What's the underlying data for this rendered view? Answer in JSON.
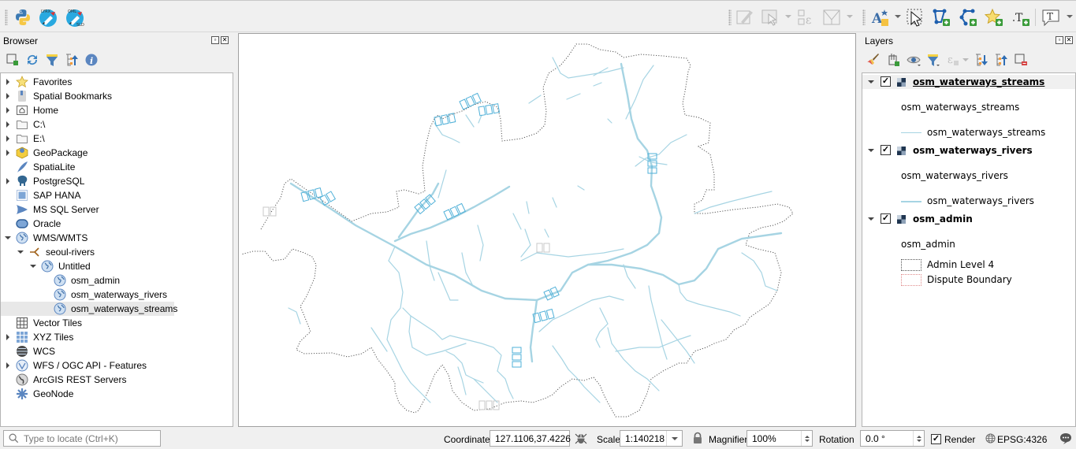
{
  "toolbar": {
    "left_icons": [
      "python-console-icon",
      "lyrx-plugin-icon",
      "qml-sld-plugin-icon"
    ],
    "lyrx_label": "LYRX",
    "qml_label": "QML",
    "sld_label": "SLD",
    "right_icons": [
      "digitize-icon",
      "select-features-icon",
      "vertex-tool-icon",
      "mesh-editing-icon",
      "label-tool-icon",
      "select-by-area-icon",
      "add-polygon-icon",
      "add-line-icon",
      "add-point-icon",
      "add-text-icon",
      "annotation-icon"
    ]
  },
  "browser": {
    "title": "Browser",
    "tools": [
      "add-layer-icon",
      "refresh-icon",
      "filter-icon",
      "collapse-all-icon",
      "info-icon"
    ],
    "items": [
      {
        "label": "Favorites",
        "icon": "star-icon",
        "expand": "collapsed",
        "level": 0
      },
      {
        "label": "Spatial Bookmarks",
        "icon": "bookmark-icon",
        "expand": "collapsed",
        "level": 0
      },
      {
        "label": "Home",
        "icon": "home-folder-icon",
        "expand": "collapsed",
        "level": 0
      },
      {
        "label": "C:\\",
        "icon": "folder-icon",
        "expand": "collapsed",
        "level": 0
      },
      {
        "label": "E:\\",
        "icon": "folder-icon",
        "expand": "collapsed",
        "level": 0
      },
      {
        "label": "GeoPackage",
        "icon": "geopackage-icon",
        "expand": "collapsed",
        "level": 0
      },
      {
        "label": "SpatiaLite",
        "icon": "spatialite-feather-icon",
        "expand": "none",
        "level": 0
      },
      {
        "label": "PostgreSQL",
        "icon": "postgresql-elephant-icon",
        "expand": "collapsed",
        "level": 0
      },
      {
        "label": "SAP HANA",
        "icon": "sap-hana-icon",
        "expand": "none",
        "level": 0
      },
      {
        "label": "MS SQL Server",
        "icon": "mssql-icon",
        "expand": "none",
        "level": 0
      },
      {
        "label": "Oracle",
        "icon": "oracle-icon",
        "expand": "none",
        "level": 0
      },
      {
        "label": "WMS/WMTS",
        "icon": "globe-icon",
        "expand": "expanded",
        "level": 0
      },
      {
        "label": "seoul-rivers",
        "icon": "connection-icon",
        "expand": "expanded",
        "level": 1
      },
      {
        "label": "Untitled",
        "icon": "globe-icon",
        "expand": "expanded",
        "level": 2
      },
      {
        "label": "osm_admin",
        "icon": "globe-icon",
        "expand": "none",
        "level": 3
      },
      {
        "label": "osm_waterways_rivers",
        "icon": "globe-icon",
        "expand": "none",
        "level": 3
      },
      {
        "label": "osm_waterways_streams",
        "icon": "globe-icon",
        "expand": "none",
        "level": 3,
        "selected": true
      },
      {
        "label": "Vector Tiles",
        "icon": "vector-tiles-icon",
        "expand": "none",
        "level": 0
      },
      {
        "label": "XYZ Tiles",
        "icon": "xyz-tiles-icon",
        "expand": "collapsed",
        "level": 0
      },
      {
        "label": "WCS",
        "icon": "wcs-icon",
        "expand": "none",
        "level": 0
      },
      {
        "label": "WFS / OGC API - Features",
        "icon": "wfs-icon",
        "expand": "collapsed",
        "level": 0
      },
      {
        "label": "ArcGIS REST Servers",
        "icon": "arcgis-icon",
        "expand": "none",
        "level": 0
      },
      {
        "label": "GeoNode",
        "icon": "geonode-icon",
        "expand": "none",
        "level": 0
      }
    ]
  },
  "layers": {
    "title": "Layers",
    "tools": [
      "style-manager-icon",
      "add-group-icon",
      "visibility-icon",
      "filter-legend-icon",
      "filter-expression-icon",
      "expand-all-icon",
      "collapse-all-icon",
      "remove-layer-icon"
    ],
    "items": [
      {
        "name": "osm_waterways_streams",
        "checked": true,
        "active": true,
        "legend_title": "osm_waterways_streams",
        "legend_entries": [
          {
            "label": "osm_waterways_streams",
            "symbol": "thin-line",
            "color": "#a6d4e3"
          }
        ]
      },
      {
        "name": "osm_waterways_rivers",
        "checked": true,
        "active": false,
        "legend_title": "osm_waterways_rivers",
        "legend_entries": [
          {
            "label": "osm_waterways_rivers",
            "symbol": "thick-line",
            "color": "#a6d4e3"
          }
        ]
      },
      {
        "name": "osm_admin",
        "checked": true,
        "active": false,
        "legend_title": "osm_admin",
        "legend_entries": [
          {
            "label": "Admin Level 4",
            "symbol": "dotted-box",
            "color": "#555555"
          },
          {
            "label": "Dispute Boundary",
            "symbol": "dotted-box",
            "color": "#e08a8a"
          }
        ]
      }
    ]
  },
  "map": {
    "river_color": "#a6d4e3",
    "label_color": "#4fb0d8",
    "boundary_color": "#555555",
    "labels": [
      "▯▯▯",
      "▯▯▯",
      "▯▯▯",
      "▯▯▯",
      "▯▯",
      "▯▯▯",
      "▯▯▯",
      "▯▯",
      "▯▯",
      "▯▯",
      "▯▯▯",
      "▯▯▯",
      "▯▯▯"
    ]
  },
  "statusbar": {
    "locate_placeholder": "Type to locate (Ctrl+K)",
    "coordinate_label": "Coordinate",
    "coordinate_value": "127.1106,37.4226",
    "scale_label": "Scale",
    "scale_value": "1:140218",
    "magnifier_label": "Magnifier",
    "magnifier_value": "100%",
    "rotation_label": "Rotation",
    "rotation_value": "0.0 °",
    "render_label": "Render",
    "render_checked": true,
    "crs_label": "EPSG:4326"
  }
}
